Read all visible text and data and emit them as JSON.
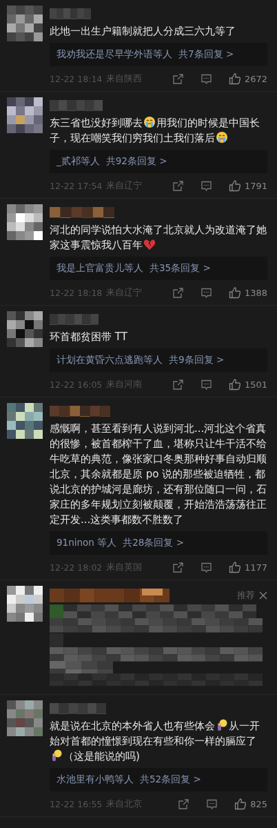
{
  "comments": [
    {
      "kind": "normal",
      "text": [
        {
          "kind": "text",
          "text": "此地一出生户籍制就把人分成三六九等了"
        }
      ],
      "reply_users": "我劝我还是尽早学外语等人",
      "reply_count": "共7条回复 >",
      "time": "12-22 18:14",
      "location": "来自陕西",
      "likes": "2672"
    },
    {
      "kind": "normal",
      "text": [
        {
          "kind": "text",
          "text": "东三省也没好到哪去"
        },
        {
          "kind": "crying-face"
        },
        {
          "kind": "text",
          "text": "用我们的时候是中国长子，现在嘲笑我们穷我们土我们落后"
        },
        {
          "kind": "crying-face"
        }
      ],
      "reply_users": "_贰祁等人",
      "reply_count": "共92条回复 >",
      "time": "12-22 17:54",
      "location": "来自辽宁",
      "likes": "1791"
    },
    {
      "kind": "normal",
      "text": [
        {
          "kind": "text",
          "text": "河北的同学说怕大水淹了北京就人为改道淹了她家这事震惊我八百年"
        },
        {
          "kind": "broken-heart"
        }
      ],
      "reply_users": "我是上官富贵儿等人",
      "reply_count": "共35条回复 >",
      "time": "12-22 18:18",
      "location": "来自辽宁",
      "likes": "1388"
    },
    {
      "kind": "normal",
      "text": [
        {
          "kind": "text",
          "text": "环首都贫困带 TT"
        }
      ],
      "reply_users": "计划在黄昏六点逃跑等人",
      "reply_count": "共9条回复 >",
      "time": "12-22 16:05",
      "location": "来自河南",
      "likes": "1501"
    },
    {
      "kind": "normal",
      "text": [
        {
          "kind": "text",
          "text": "感慨啊，甚至看到有人说到河北...河北这个省真的很惨，被首都榨干了血，堪称只让牛干活不给牛吃草的典范，像张家口冬奥那种好事自动归顺北京，其余就都是原 po 说的那些被迫牺牲，都说北京的护城河是廊坊，还有那位随口一问，石家庄的多年规划立刻被颠覆，开始浩浩荡荡往正定开发...这类事都数不胜数了"
        }
      ],
      "reply_users": "91ninon 等人",
      "reply_count": "共28条回复 >",
      "time": "12-22 18:02",
      "location": "来自英国",
      "likes": "1177"
    },
    {
      "kind": "blurred",
      "badge": "推荐"
    },
    {
      "kind": "normal",
      "text": [
        {
          "kind": "text",
          "text": "就是说在北京的本外省人也有些体会"
        },
        {
          "kind": "bulb"
        },
        {
          "kind": "text",
          "text": "从一开始对首都的憧憬到现在有些和你一样的膈应了"
        },
        {
          "kind": "bulb"
        },
        {
          "kind": "text",
          "text": "（这是能说的吗)"
        }
      ],
      "reply_users": "水池里有小鸭等人",
      "reply_count": "共52条回复 >",
      "time": "12-22 16:55",
      "location": "来自北京",
      "likes": "825"
    }
  ]
}
